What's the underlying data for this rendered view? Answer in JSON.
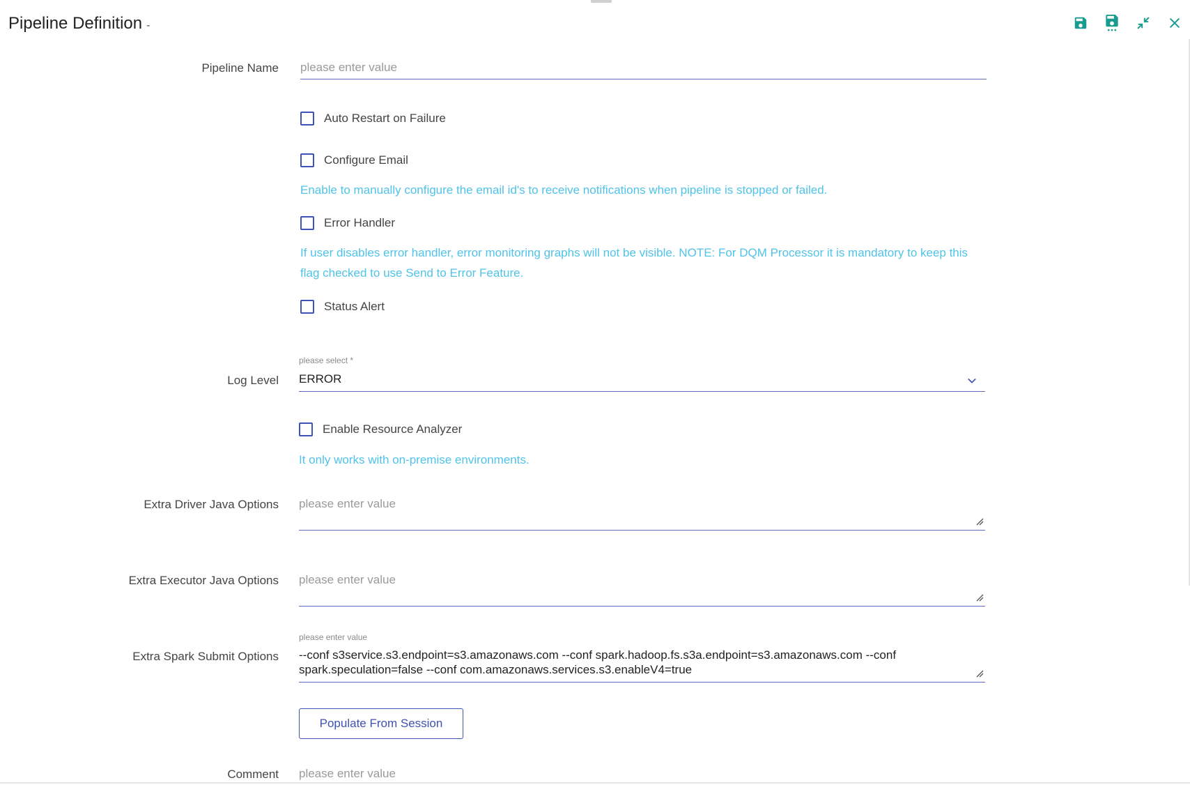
{
  "header": {
    "title": "Pipeline Definition",
    "title_suffix": "-"
  },
  "toolbar": {
    "icons": [
      "save-icon",
      "save-all-icon",
      "minimize-icon",
      "close-icon"
    ],
    "accent": "#1a9b8f"
  },
  "form": {
    "pipeline_name": {
      "label": "Pipeline Name",
      "placeholder": "please enter value",
      "value": ""
    },
    "auto_restart": {
      "label": "Auto Restart on Failure",
      "checked": false
    },
    "configure_email": {
      "label": "Configure Email",
      "checked": false,
      "hint": "Enable to manually configure the email id's to receive notifications when pipeline is stopped or failed."
    },
    "error_handler": {
      "label": "Error Handler",
      "checked": false,
      "hint": "If user disables error handler, error monitoring graphs will not be visible. NOTE: For DQM Processor it is mandatory to keep this flag checked to use Send to Error Feature."
    },
    "status_alert": {
      "label": "Status Alert",
      "checked": false
    },
    "log_level": {
      "label": "Log Level",
      "float_label": "please select *",
      "value": "ERROR"
    },
    "resource_analyzer": {
      "label": "Enable Resource Analyzer",
      "checked": false,
      "hint": "It only works with on-premise environments."
    },
    "extra_driver": {
      "label": "Extra Driver Java Options",
      "placeholder": "please enter value",
      "value": ""
    },
    "extra_executor": {
      "label": "Extra Executor Java Options",
      "placeholder": "please enter value",
      "value": ""
    },
    "extra_spark": {
      "label": "Extra Spark Submit Options",
      "float_label": "please enter value",
      "line1": "--conf s3service.s3.endpoint=s3.amazonaws.com --conf spark.hadoop.fs.s3a.endpoint=s3.amazonaws.com --conf",
      "line2": "spark.speculation=false --conf com.amazonaws.services.s3.enableV4=true"
    },
    "populate_button": "Populate From Session",
    "comment": {
      "label": "Comment",
      "placeholder": "please enter value"
    }
  }
}
